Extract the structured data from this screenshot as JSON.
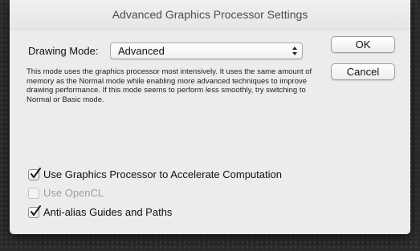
{
  "dialog": {
    "title": "Advanced Graphics Processor Settings"
  },
  "drawing_mode": {
    "label": "Drawing Mode:",
    "selected": "Advanced"
  },
  "description": "This mode uses the graphics processor most intensively.  It uses the same amount of memory as the Normal mode while enabling more advanced techniques to improve drawing performance.  If this mode seems to perform less smoothly, try switching to Normal or Basic mode.",
  "buttons": {
    "ok": "OK",
    "cancel": "Cancel"
  },
  "options": [
    {
      "label": "Use Graphics Processor to Accelerate Computation",
      "checked": true,
      "enabled": true
    },
    {
      "label": "Use OpenCL",
      "checked": false,
      "enabled": false
    },
    {
      "label": "Anti-alias Guides and Paths",
      "checked": true,
      "enabled": true
    }
  ],
  "icons": {
    "select_arrows": "up-down-chevron-icon",
    "checkmark": "checkmark-icon"
  }
}
